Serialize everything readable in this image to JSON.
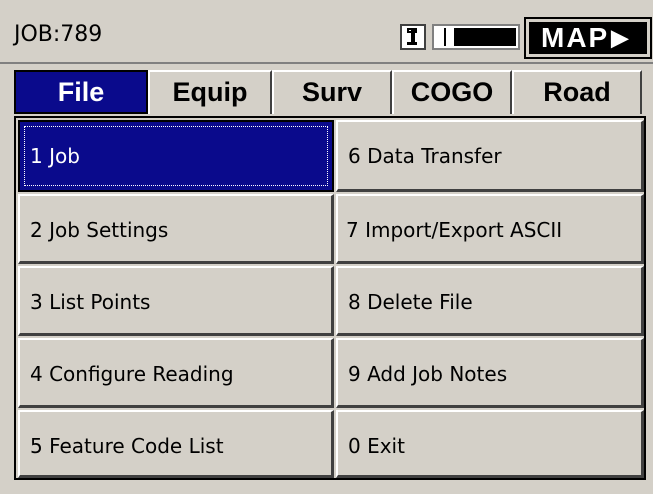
{
  "header": {
    "job_title": "JOB:789",
    "map_label": "MAP",
    "map_arrow": "▶"
  },
  "tabs": [
    {
      "label": "File",
      "active": true
    },
    {
      "label": "Equip",
      "active": false
    },
    {
      "label": "Surv",
      "active": false
    },
    {
      "label": "COGO",
      "active": false
    },
    {
      "label": "Road",
      "active": false
    }
  ],
  "menu": {
    "left": [
      {
        "label": "1 Job",
        "selected": true
      },
      {
        "label": "2 Job Settings"
      },
      {
        "label": "3 List Points"
      },
      {
        "label": "4 Configure Reading"
      },
      {
        "label": "5 Feature Code List"
      }
    ],
    "right": [
      {
        "label": "6 Data Transfer"
      },
      {
        "label": "7 Import/Export ASCII"
      },
      {
        "label": "8 Delete File"
      },
      {
        "label": "9 Add Job Notes"
      },
      {
        "label": "0 Exit"
      }
    ]
  },
  "icons": {
    "status": "key-icon",
    "battery": "battery-level-icon"
  },
  "colors": {
    "accent": "#0a0a8c",
    "background": "#d4d0c8"
  }
}
